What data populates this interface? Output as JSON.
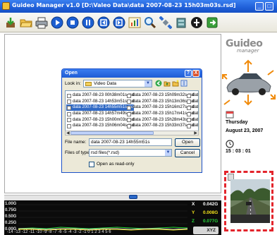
{
  "window": {
    "title": "Guideo Manager v1.0 [D:\\Valeo Data\\data 2007-08-23 15h03m03s.rsd]"
  },
  "side": {
    "logo_main": "Guideo",
    "logo_sub": "manager",
    "day": "Thursday",
    "date": "August 23, 2007",
    "time": "15 : 03 : 01"
  },
  "graph": {
    "y_labels": [
      "1.00G",
      "0.75G",
      "0.50G",
      "0.25G",
      "0.00G"
    ],
    "x_ticks": "-14 -13 -12 -11 -10 -9 -8 -7 -6 -5 -4 -3 -2 -1 0 1 2 3 4 5 6",
    "axes": [
      {
        "axis": "X",
        "value": "0.042G",
        "color": "#ffffff"
      },
      {
        "axis": "Y",
        "value": "0.008G",
        "color": "#f2e21b"
      },
      {
        "axis": "Z",
        "value": "0.077G",
        "color": "#27d63a"
      }
    ],
    "badge": "XYZ"
  },
  "dialog": {
    "title": "Open",
    "help": "?",
    "close": "X",
    "look_in_label": "Look in:",
    "look_in_value": "Video Data",
    "columns": [
      [
        "data 2007-08-23 00h38m01s.rsd",
        "data 2007-08-23 14h53m51s.rsd",
        "data 2007-08-23 14h55m51s.rsd",
        "data 2007-08-23 14h57m49s.rsd",
        "data 2007-08-23 15h00m03s.rsd",
        "data 2007-08-23 15h06m04s.rsd"
      ],
      [
        "data 2007-08-23 15h09m32s.rsd",
        "data 2007-08-23 15h13m36s.rsd",
        "data 2007-08-23 15h16m27s.rsd",
        "data 2007-08-23 15h17m41s.rsd",
        "data 2007-08-23 15h28m43s.rsd",
        "data 2007-08-23 15h33m37s.rsd"
      ],
      [
        "dat",
        "dat",
        "dat",
        "dat",
        "dat",
        "dat"
      ]
    ],
    "selected": {
      "col": 0,
      "row": 2
    },
    "file_name_label": "File name:",
    "file_name_value": "data 2007-08-23 14h55m51s",
    "file_type_label": "Files of type:",
    "file_type_value": "rsd files(*.rsd)",
    "open_button": "Open",
    "cancel_button": "Cancel",
    "readonly_label": "Open as read-only"
  }
}
